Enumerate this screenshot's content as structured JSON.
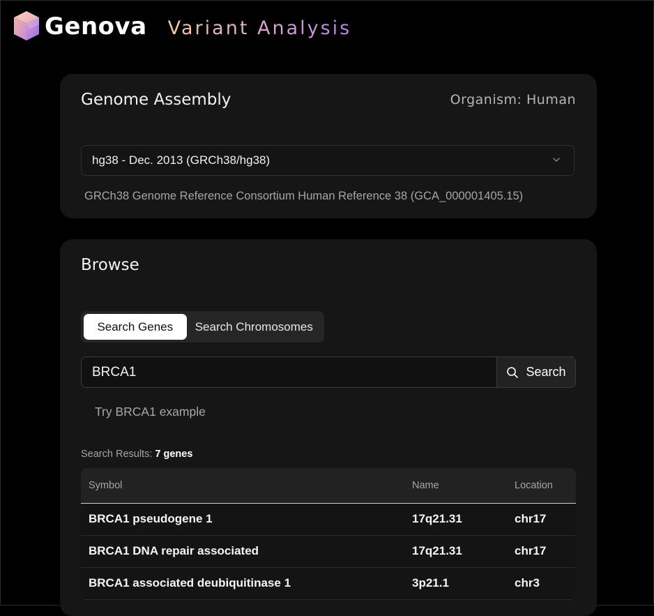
{
  "header": {
    "brand": "Genova",
    "subtitle": "Variant Analysis"
  },
  "assembly": {
    "title": "Genome Assembly",
    "organism": "Organism: Human",
    "selected": "hg38 - Dec. 2013 (GRCh38/hg38)",
    "description": "GRCh38 Genome Reference Consortium Human Reference 38 (GCA_000001405.15)"
  },
  "browse": {
    "title": "Browse",
    "tabs": [
      {
        "label": "Search Genes",
        "active": true
      },
      {
        "label": "Search Chromosomes",
        "active": false
      }
    ],
    "search": {
      "value": "BRCA1",
      "button_label": "Search"
    },
    "try_example": "Try BRCA1 example",
    "results": {
      "label": "Search Results: ",
      "count": "7 genes",
      "columns": [
        "Symbol",
        "Name",
        "Location"
      ],
      "rows": [
        [
          "BRCA1 pseudogene 1",
          "17q21.31",
          "chr17"
        ],
        [
          "BRCA1 DNA repair associated",
          "17q21.31",
          "chr17"
        ],
        [
          "BRCA1 associated deubiquitinase 1",
          "3p21.1",
          "chr3"
        ]
      ]
    }
  },
  "colors": {
    "background": "#000000",
    "card": "#161616",
    "accent_gradient": [
      "#f3c9a8",
      "#b487e4"
    ]
  },
  "icons": [
    "cube-logo-icon",
    "chevron-down-icon",
    "search-icon"
  ]
}
